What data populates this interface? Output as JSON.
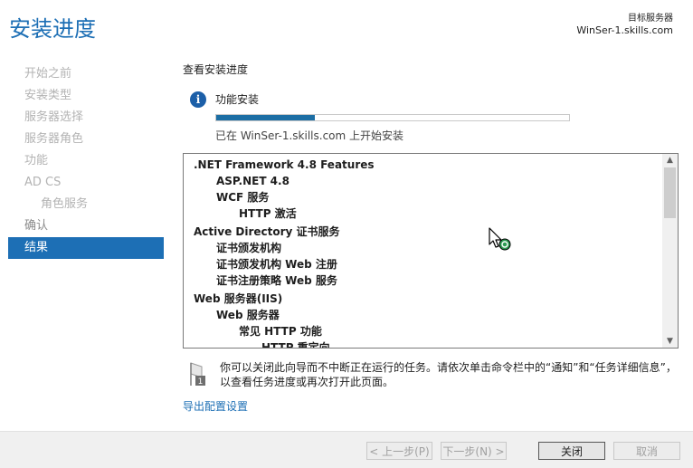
{
  "page": {
    "title": "安装进度",
    "target_label": "目标服务器",
    "target_server": "WinSer-1.skills.com"
  },
  "nav": {
    "items": [
      {
        "label": "开始之前",
        "state": "disabled"
      },
      {
        "label": "安装类型",
        "state": "disabled"
      },
      {
        "label": "服务器选择",
        "state": "disabled"
      },
      {
        "label": "服务器角色",
        "state": "disabled"
      },
      {
        "label": "功能",
        "state": "disabled"
      },
      {
        "label": "AD CS",
        "state": "disabled"
      },
      {
        "label": "角色服务",
        "state": "disabled",
        "sub": true
      },
      {
        "label": "确认",
        "state": "enabled"
      },
      {
        "label": "结果",
        "state": "active"
      }
    ]
  },
  "main": {
    "section_title": "查看安装进度",
    "status_title": "功能安装",
    "progress_fraction": 0.28,
    "progress_text": "已在 WinSer-1.skills.com 上开始安装",
    "features": [
      {
        "text": ".NET Framework 4.8 Features",
        "level": 0
      },
      {
        "text": "ASP.NET 4.8",
        "level": 1
      },
      {
        "text": "WCF 服务",
        "level": 1
      },
      {
        "text": "HTTP 激活",
        "level": 2
      },
      {
        "text": "Active Directory 证书服务",
        "level": 0
      },
      {
        "text": "证书颁发机构",
        "level": 1
      },
      {
        "text": "证书颁发机构 Web 注册",
        "level": 1
      },
      {
        "text": "证书注册策略 Web 服务",
        "level": 1
      },
      {
        "text": "Web 服务器(IIS)",
        "level": 0
      },
      {
        "text": "Web 服务器",
        "level": 1
      },
      {
        "text": "常见 HTTP 功能",
        "level": 2
      },
      {
        "text": "HTTP 重定向",
        "level": 3
      }
    ],
    "note": "你可以关闭此向导而不中断正在运行的任务。请依次单击命令栏中的“通知”和“任务详细信息”，以查看任务进度或再次打开此页面。",
    "export_link": "导出配置设置"
  },
  "footer": {
    "prev": "< 上一步(P)",
    "next": "下一步(N) >",
    "close": "关闭",
    "cancel": "取消"
  },
  "colors": {
    "accent": "#1d6fb5",
    "progress": "#1c6ea4"
  },
  "icons": {
    "info": "info-icon",
    "note": "notification-flag-icon",
    "cursor": "busy-pointer-icon"
  }
}
